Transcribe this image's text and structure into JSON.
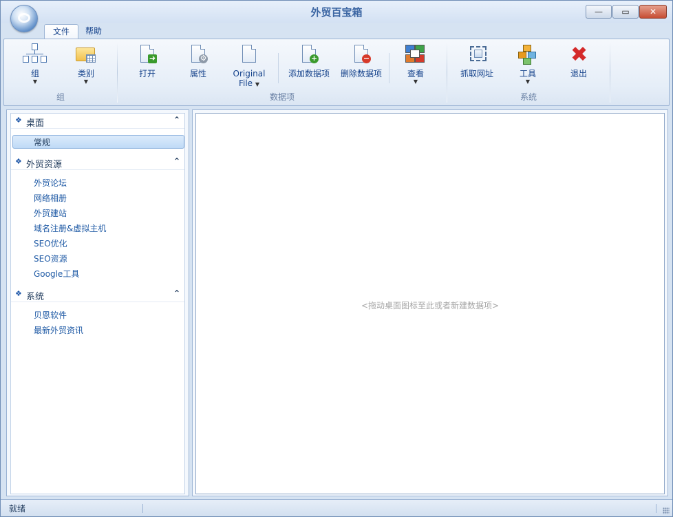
{
  "window": {
    "title": "外贸百宝箱"
  },
  "menu_tabs": [
    {
      "label": "文件",
      "active": true
    },
    {
      "label": "帮助",
      "active": false
    }
  ],
  "ribbon": {
    "groups": [
      {
        "label": "组",
        "buttons": [
          {
            "label": "组",
            "icon": "group-tree-icon",
            "has_dropdown": true
          },
          {
            "label": "类别",
            "icon": "category-folder-icon",
            "has_dropdown": true
          }
        ]
      },
      {
        "label": "数据项",
        "buttons": [
          {
            "label": "打开",
            "icon": "open-document-icon"
          },
          {
            "label": "属性",
            "icon": "properties-document-icon"
          },
          {
            "label": "Original File",
            "label_line1": "Original",
            "label_line2": "File",
            "icon": "original-file-icon",
            "has_dropdown": true
          },
          {
            "label": "添加数据项",
            "icon": "add-item-icon"
          },
          {
            "label": "删除数据项",
            "icon": "delete-item-icon"
          },
          {
            "label": "查看",
            "icon": "view-icon",
            "has_dropdown": true
          }
        ]
      },
      {
        "label": "系统",
        "buttons": [
          {
            "label": "抓取网址",
            "icon": "capture-url-icon"
          },
          {
            "label": "工具",
            "icon": "tools-cubes-icon",
            "has_dropdown": true
          },
          {
            "label": "退出",
            "icon": "exit-x-icon"
          }
        ]
      }
    ]
  },
  "sidebar": {
    "sections": [
      {
        "title": "桌面",
        "items": [
          {
            "label": "常规",
            "selected": true
          }
        ]
      },
      {
        "title": "外贸资源",
        "items": [
          {
            "label": "外贸论坛"
          },
          {
            "label": "网络相册"
          },
          {
            "label": "外贸建站"
          },
          {
            "label": "域名注册&虚拟主机"
          },
          {
            "label": "SEO优化"
          },
          {
            "label": "SEO资源"
          },
          {
            "label": "Google工具"
          }
        ]
      },
      {
        "title": "系统",
        "items": [
          {
            "label": "贝恩软件"
          },
          {
            "label": "最新外贸资讯"
          }
        ]
      }
    ]
  },
  "main": {
    "empty_hint": "<拖动桌面图标至此或者新建数据项>"
  },
  "statusbar": {
    "text": "就绪"
  },
  "colors": {
    "accent": "#15428b",
    "link": "#1f5aa5",
    "selection": "#bfdaf6",
    "close": "#c64d33"
  }
}
